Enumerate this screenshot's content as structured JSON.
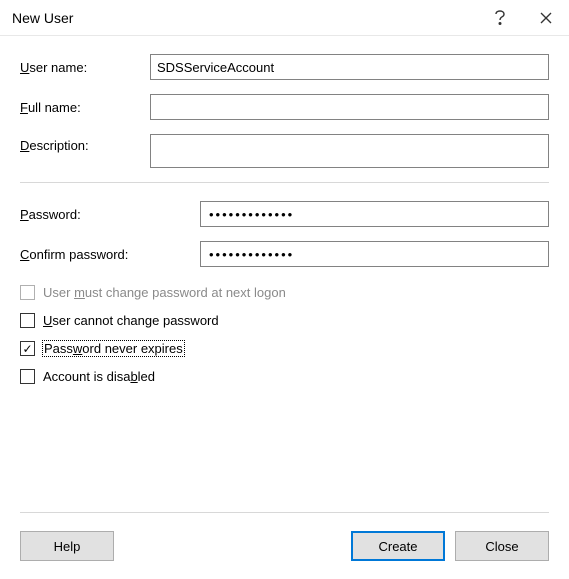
{
  "title": "New User",
  "fields": {
    "username": {
      "label_pre": "U",
      "label_post": "ser name:",
      "value": "SDSServiceAccount"
    },
    "fullname": {
      "label_pre": "F",
      "label_post": "ull name:",
      "value": ""
    },
    "description": {
      "label_pre": "D",
      "label_post": "escription:",
      "value": ""
    },
    "password": {
      "label_pre": "P",
      "label_post": "assword:",
      "value": "•••••••••••••"
    },
    "confirm": {
      "label_pre": "C",
      "label_post": "onfirm password:",
      "value": "•••••••••••••"
    }
  },
  "checks": {
    "must_change": {
      "pre": "User ",
      "ul": "m",
      "post": "ust change password at next logon",
      "checked": false,
      "enabled": false
    },
    "cannot_change": {
      "pre": "",
      "ul": "U",
      "post": "ser cannot change password",
      "checked": false,
      "enabled": true
    },
    "never_expires": {
      "pre": "Pass",
      "ul": "w",
      "post": "ord never expires",
      "checked": true,
      "enabled": true,
      "focused": true
    },
    "disabled": {
      "pre": "Account is disa",
      "ul": "b",
      "post": "led",
      "checked": false,
      "enabled": true
    }
  },
  "buttons": {
    "help_pre": "",
    "help_ul": "H",
    "help_post": "elp",
    "create": "Create",
    "close": "Close"
  }
}
